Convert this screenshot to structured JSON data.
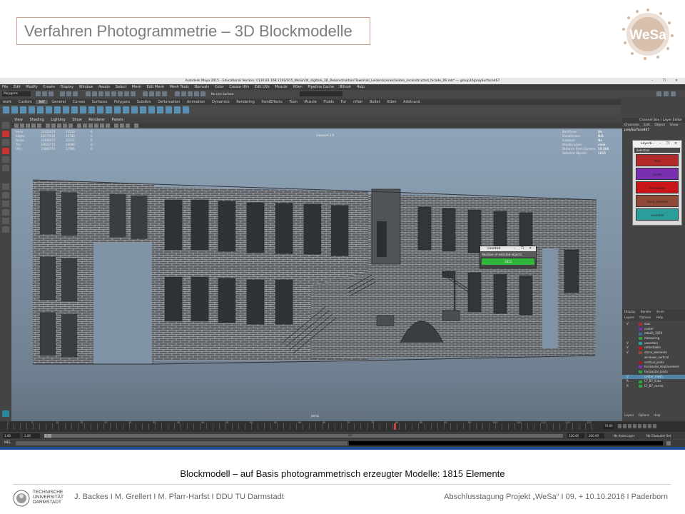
{
  "slide": {
    "title": "Verfahren Photogrammetrie – 3D Blockmodelle",
    "caption": "Blockmodell – auf Basis photogrammetrisch erzeugter Modelle: 1815 Elemente",
    "logo_text": "WeSa",
    "logo_color": "#c9a48a",
    "footer_left": "J. Backes I M. Grellert I M. Pfarr-Harfst I DDU TU Darmstadt",
    "footer_right": "Abschlusstagung Projekt „WeSa“ I 09. + 10.10.2016 I Paderborn",
    "university": [
      "TECHNISCHE",
      "UNIVERSITÄT",
      "DARMSTADT"
    ]
  },
  "maya": {
    "window_title": "Autodesk Maya 2015 - Educational Version: \\\\130.83.168.110\\2015_WeSa\\04_digitale_3D_Rekonstruktion\\TownHall_Leiden\\scenes\\leiden_reconstructed_facade_09.mb* --- group16|polySurface467",
    "window_buttons": "– ❐ ✕",
    "menu": [
      "File",
      "Edit",
      "Modify",
      "Create",
      "Display",
      "Window",
      "Assets",
      "Select",
      "Mesh",
      "Edit Mesh",
      "Mesh Tools",
      "Normals",
      "Color",
      "Create UVs",
      "Edit UVs",
      "Muscle",
      "XGen",
      "Pipeline Cache",
      "Bifrost",
      "Help"
    ],
    "mode": "Polygons",
    "live_surface": "No Live Surface",
    "shelf_tabs": [
      "work",
      "Custom",
      "Intf",
      "General",
      "Curves",
      "Surfaces",
      "Polygons",
      "Subdivs",
      "Deformation",
      "Animation",
      "Dynamics",
      "Rendering",
      "PaintEffects",
      "Toon",
      "Muscle",
      "Fluids",
      "Fur",
      "nHair",
      "Bullet",
      "XGen",
      "Arbitrand"
    ],
    "shelf_active": 2,
    "panel_menu": [
      "View",
      "Shading",
      "Lighting",
      "Show",
      "Renderer",
      "Panels"
    ],
    "viewport_label": "Viewport 2.0",
    "camera_label": "persp",
    "hud_left": [
      {
        "label": "Verts:",
        "a": "12322474",
        "b": "13556",
        "c": "0"
      },
      {
        "label": "Edges:",
        "a": "24579930",
        "b": "26780",
        "c": "0"
      },
      {
        "label": "Faces:",
        "a": "12408677",
        "b": "13255",
        "c": "0"
      },
      {
        "label": "Tris:",
        "a": "24610772",
        "b": "24080",
        "c": "0"
      },
      {
        "label": "UVs:",
        "a": "15846703",
        "b": "27096",
        "c": "0"
      }
    ],
    "hud_right": [
      {
        "label": "Backfaces:",
        "value": "On"
      },
      {
        "label": "Smoothness:",
        "value": "N/A"
      },
      {
        "label": "Instance:",
        "value": "No"
      },
      {
        "label": "Display Layer:",
        "value": "view"
      },
      {
        "label": "Distance From Camera:",
        "value": "18.368"
      },
      {
        "label": "Selected Objects:",
        "value": "1815"
      }
    ],
    "counted_window": {
      "title": "counted",
      "buttons": "– ❐ ✕",
      "label": "Number of selected objects:",
      "value": "1815",
      "value_color": "#2fb53a"
    },
    "right_panel": {
      "header": "Channel Box / Layer Editor",
      "tabs": [
        "Channels",
        "Edit",
        "Object",
        "Show"
      ],
      "object": "polySurface467"
    },
    "layer_window": {
      "title": "Layerb...",
      "buttons": "– ❐ ✕",
      "section": "Selection",
      "buttons_list": [
        {
          "label": "stair",
          "color": "#b22a2a"
        },
        {
          "label": "center",
          "color": "#7a2fb0"
        },
        {
          "label": "remarkable",
          "color": "#c8161b"
        },
        {
          "label": "stone_element",
          "color": "#8f4a38"
        },
        {
          "label": "uncertain",
          "color": "#2a9e9a"
        }
      ]
    },
    "layer_tabs": [
      "Display",
      "Render",
      "Anim"
    ],
    "layer_tabs2": [
      "Layers",
      "Options",
      "Help"
    ],
    "layers": [
      {
        "v": "V",
        "name": "stair",
        "color": "#b22a2a"
      },
      {
        "v": "",
        "name": "center",
        "color": "#7a2fb0"
      },
      {
        "v": "",
        "name": "rebuilt_1929",
        "color": "#2d6e9e"
      },
      {
        "v": "",
        "name": "measuring",
        "color": "#3a9a3a"
      },
      {
        "v": "V",
        "name": "uncertain",
        "color": "#2a9e9a"
      },
      {
        "v": "V",
        "name": "remarkable",
        "color": "#c8161b"
      },
      {
        "v": "V",
        "name": "stone_elements",
        "color": "#8f4a38"
      },
      {
        "v": "",
        "name": "windows_vertical",
        "color": "#444444"
      },
      {
        "v": "",
        "name": "vertical_joints",
        "color": "#a01c1c"
      },
      {
        "v": "",
        "name": "horizontal_displacement",
        "color": "#7a2fb0"
      },
      {
        "v": "",
        "name": "horizontal_joints",
        "color": "#2fa33a"
      },
      {
        "v": "V",
        "name": "center_mesh",
        "color": "#5285a6",
        "selected": true
      },
      {
        "v": "R",
        "name": "L7_B7_links",
        "color": "#2fa33a"
      },
      {
        "v": "R",
        "name": "L7_B7_rechts",
        "color": "#2fa33a"
      }
    ],
    "timeline": {
      "ticks": [
        "1",
        "5",
        "10",
        "15",
        "20",
        "25",
        "30",
        "35",
        "40",
        "45",
        "50",
        "55",
        "60",
        "65",
        "70",
        "75",
        "80",
        "85",
        "90",
        "95",
        "100",
        "105",
        "110",
        "115",
        "120"
      ],
      "current_frame": "70.00",
      "range_start": "1.00",
      "range_start2": "1.00",
      "range_mid_left": "1",
      "range_mid_right": "120",
      "range_end": "120.00",
      "range_end2": "200.00",
      "anim_layer": "No Anim Layer",
      "char_set": "No Character Set"
    },
    "mel_label": "MEL"
  }
}
